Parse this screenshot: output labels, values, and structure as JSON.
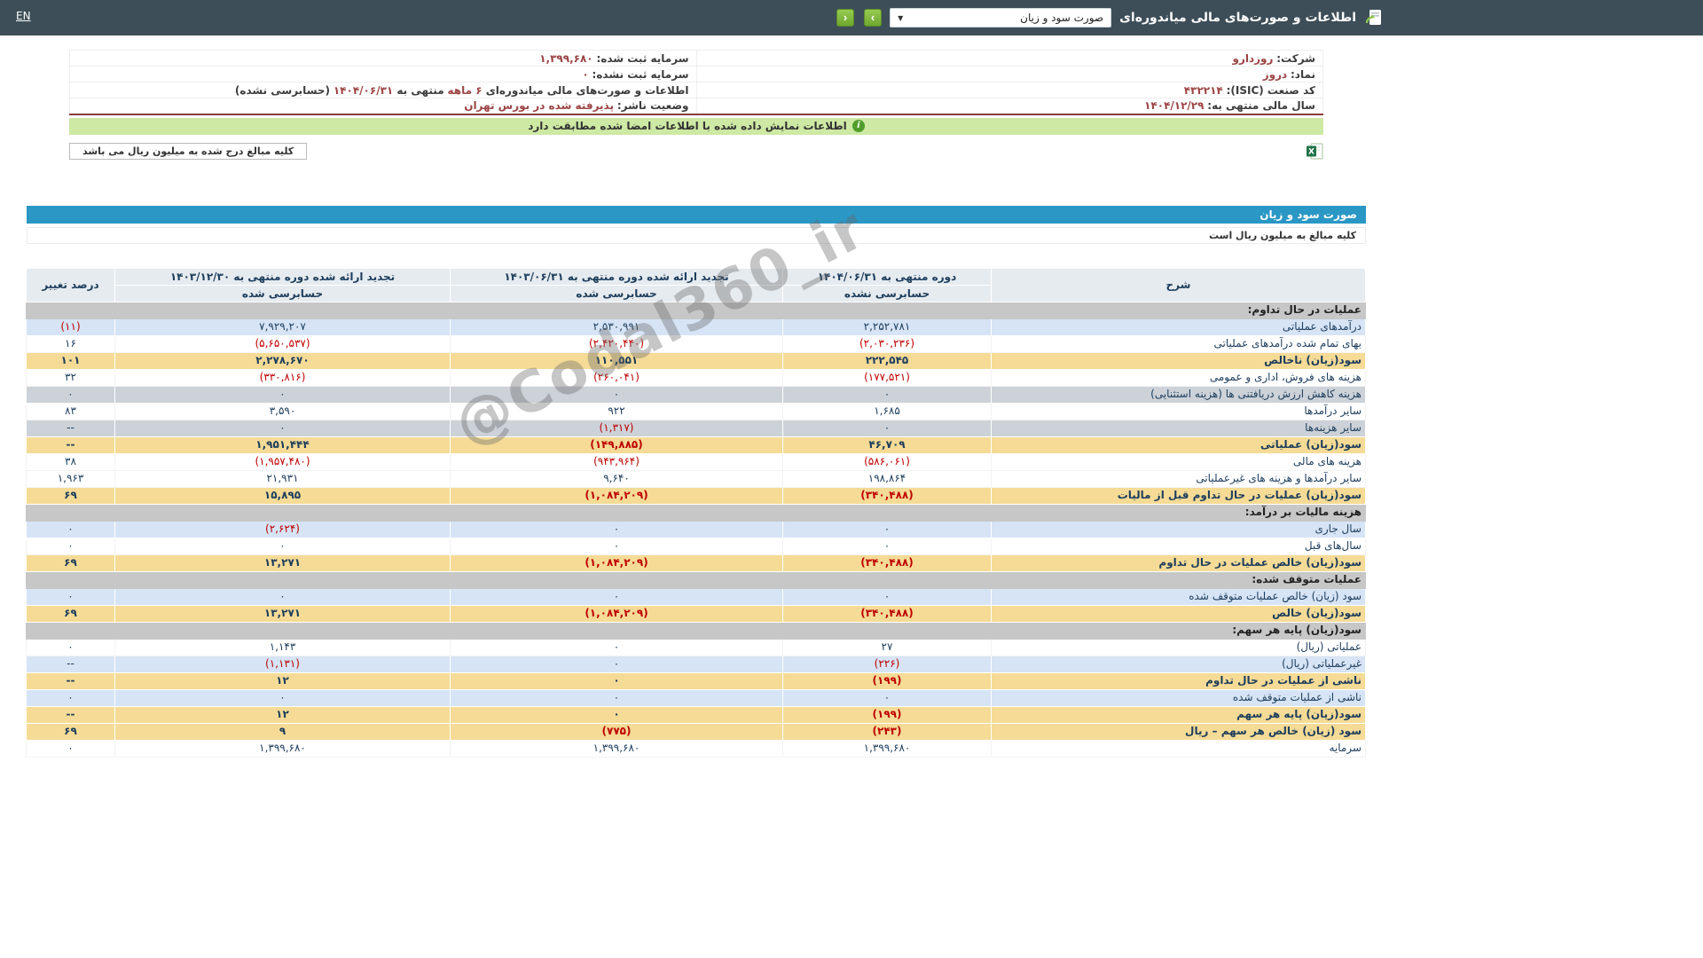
{
  "navbar": {
    "language_label": "EN",
    "title": "اطلاعات و صورت‌های مالی میاندوره‌ای",
    "statement_dropdown_value": "صورت سود و زیان",
    "caret_glyph": "▼",
    "forward_glyph": "›",
    "back_glyph": "‹"
  },
  "company_info": {
    "company_label": "شرکت:",
    "company_value": "روزدارو",
    "registered_capital_label": "سرمایه ثبت شده:",
    "registered_capital_value": "۱,۳۹۹,۶۸۰",
    "symbol_label": "نماد:",
    "symbol_value": "دروز",
    "unregistered_capital_label": "سرمایه ثبت نشده:",
    "unregistered_capital_value": "۰",
    "isic_label": "کد صنعت (ISIC):",
    "isic_value": "۴۳۲۲۱۴",
    "report_p1": "اطلاعات و صورت‌های مالی میاندوره‌ای ",
    "report_p2": "۶ ماهه",
    "report_p3": " منتهی به ",
    "report_p4": "۱۴۰۴/۰۶/۳۱",
    "report_p5": "(حسابرسی نشده)",
    "fiscal_year_label": "سال مالی منتهی به:",
    "fiscal_year_value": "۱۴۰۴/۱۲/۲۹",
    "publisher_status_label": "وضعیت ناشر:",
    "publisher_status_value": "پذیرفته شده در بورس تهران"
  },
  "banner": {
    "info_icon_glyph": "i",
    "message": "اطلاعات نمایش داده شده با اطلاعات امضا شده مطابقت دارد"
  },
  "units_note_tab": "کلیه مبالغ درج شده به میلیون ریال می باشد",
  "statement": {
    "title": "صورت سود و زیان",
    "units_note": "کلیه مبالغ به میلیون ریال است",
    "watermark": "@Codal360_ir",
    "headers": {
      "description": "شرح",
      "period1_title": "دوره منتهی به ۱۴۰۴/۰۶/۳۱",
      "period1_audit": "حسابرسی نشده",
      "period2_title": "تجدید ارائه شده دوره منتهی به ۱۴۰۳/۰۶/۳۱",
      "period2_audit": "حسابرسی شده",
      "period3_title": "تجدید ارائه شده دوره منتهی به ۱۴۰۳/۱۲/۳۰",
      "period3_audit": "حسابرسی شده",
      "change_percent": "درصد تغییر"
    },
    "rows": [
      {
        "label": "عملیات در حال تداوم:",
        "type": "section",
        "v1": "",
        "v2": "",
        "v3": "",
        "chg": ""
      },
      {
        "label": "درآمدهای عملیاتی",
        "type": "blue",
        "v1": "۲,۲۵۲,۷۸۱",
        "v2": "۲,۵۳۰,۹۹۱",
        "v3": "۷,۹۲۹,۲۰۷",
        "chg": "(۱۱)"
      },
      {
        "label": "بهای تمام شده درآمدهای عملیاتی",
        "type": "white",
        "v1": "(۲,۰۳۰,۲۳۶)",
        "v2": "(۲,۴۲۰,۴۴۰)",
        "v3": "(۵,۶۵۰,۵۳۷)",
        "chg": "۱۶"
      },
      {
        "label": "سود(زیان) ناخالص",
        "type": "yellow",
        "v1": "۲۲۲,۵۴۵",
        "v2": "۱۱۰,۵۵۱",
        "v3": "۲,۲۷۸,۶۷۰",
        "chg": "۱۰۱"
      },
      {
        "label": "هزینه های فروش، اداری و عمومی",
        "type": "white",
        "v1": "(۱۷۷,۵۲۱)",
        "v2": "(۲۶۰,۰۴۱)",
        "v3": "(۳۳۰,۸۱۶)",
        "chg": "۳۲"
      },
      {
        "label": "هزینه کاهش ارزش دریافتنی ها (هزینه استثنایی)",
        "type": "muted",
        "v1": "۰",
        "v2": "۰",
        "v3": "۰",
        "chg": "۰"
      },
      {
        "label": "سایر درآمدها",
        "type": "white",
        "v1": "۱,۶۸۵",
        "v2": "۹۲۲",
        "v3": "۳,۵۹۰",
        "chg": "۸۳"
      },
      {
        "label": "سایر هزینه‌ها",
        "type": "muted",
        "v1": "۰",
        "v2": "(۱,۳۱۷)",
        "v3": "۰",
        "chg": "--"
      },
      {
        "label": "سود(زیان) عملیاتی",
        "type": "yellow",
        "v1": "۴۶,۷۰۹",
        "v2": "(۱۴۹,۸۸۵)",
        "v3": "۱,۹۵۱,۴۴۴",
        "chg": "--"
      },
      {
        "label": "هزینه های مالی",
        "type": "white",
        "v1": "(۵۸۶,۰۶۱)",
        "v2": "(۹۴۳,۹۶۴)",
        "v3": "(۱,۹۵۷,۴۸۰)",
        "chg": "۳۸"
      },
      {
        "label": "سایر درآمدها و هزینه های غیرعملیاتی",
        "type": "white",
        "v1": "۱۹۸,۸۶۴",
        "v2": "۹,۶۴۰",
        "v3": "۲۱,۹۳۱",
        "chg": "۱,۹۶۳"
      },
      {
        "label": "سود(زیان) عملیات در حال تداوم قبل از مالیات",
        "type": "yellow",
        "v1": "(۳۴۰,۴۸۸)",
        "v2": "(۱,۰۸۴,۲۰۹)",
        "v3": "۱۵,۸۹۵",
        "chg": "۶۹"
      },
      {
        "label": "هزینه مالیات بر درآمد:",
        "type": "section",
        "v1": "",
        "v2": "",
        "v3": "",
        "chg": ""
      },
      {
        "label": "سال جاری",
        "type": "blue",
        "v1": "۰",
        "v2": "۰",
        "v3": "(۲,۶۲۴)",
        "chg": "۰"
      },
      {
        "label": "سال‌های قبل",
        "type": "white",
        "v1": "۰",
        "v2": "۰",
        "v3": "۰",
        "chg": "۰"
      },
      {
        "label": "سود(زیان) خالص عملیات در حال تداوم",
        "type": "yellow",
        "v1": "(۳۴۰,۴۸۸)",
        "v2": "(۱,۰۸۴,۲۰۹)",
        "v3": "۱۳,۲۷۱",
        "chg": "۶۹"
      },
      {
        "label": "عملیات متوقف شده:",
        "type": "section",
        "v1": "",
        "v2": "",
        "v3": "",
        "chg": ""
      },
      {
        "label": "سود (زیان) خالص عملیات متوقف شده",
        "type": "blue",
        "v1": "۰",
        "v2": "۰",
        "v3": "۰",
        "chg": "۰"
      },
      {
        "label": "سود(زیان) خالص",
        "type": "yellow",
        "v1": "(۳۴۰,۴۸۸)",
        "v2": "(۱,۰۸۴,۲۰۹)",
        "v3": "۱۳,۲۷۱",
        "chg": "۶۹"
      },
      {
        "label": "سود(زیان) پایه هر سهم:",
        "type": "section",
        "v1": "",
        "v2": "",
        "v3": "",
        "chg": ""
      },
      {
        "label": "عملیاتی (ریال)",
        "type": "white",
        "v1": "۲۷",
        "v2": "۰",
        "v3": "۱,۱۴۳",
        "chg": "۰"
      },
      {
        "label": "غیرعملیاتی (ریال)",
        "type": "blue",
        "v1": "(۲۲۶)",
        "v2": "۰",
        "v3": "(۱,۱۳۱)",
        "chg": "--"
      },
      {
        "label": "ناشی از عملیات در حال تداوم",
        "type": "yellow",
        "v1": "(۱۹۹)",
        "v2": "۰",
        "v3": "۱۲",
        "chg": "--"
      },
      {
        "label": "ناشی از عملیات متوقف شده",
        "type": "blue",
        "v1": "۰",
        "v2": "۰",
        "v3": "۰",
        "chg": "۰"
      },
      {
        "label": "سود(زیان) پایه هر سهم",
        "type": "yellow",
        "v1": "(۱۹۹)",
        "v2": "۰",
        "v3": "۱۲",
        "chg": "--"
      },
      {
        "label": "سود (زیان) خالص هر سهم – ریال",
        "type": "yellow",
        "v1": "(۲۴۳)",
        "v2": "(۷۷۵)",
        "v3": "۹",
        "chg": "۶۹"
      },
      {
        "label": "سرمایه",
        "type": "white",
        "v1": "۱,۳۹۹,۶۸۰",
        "v2": "۱,۳۹۹,۶۸۰",
        "v3": "۱,۳۹۹,۶۸۰",
        "chg": "۰"
      }
    ]
  },
  "colors": {
    "navbar_bg": "#3d4e58",
    "accent_green": "#7cb342",
    "header_blue": "#2a97c5",
    "negative_red": "#bf0000",
    "row_yellow": "#f5db96",
    "row_blue": "#d6e4f5",
    "section_gray": "#c7c7c7",
    "info_value_maroon": "#9c4444",
    "banner_green": "#cde9a4"
  }
}
